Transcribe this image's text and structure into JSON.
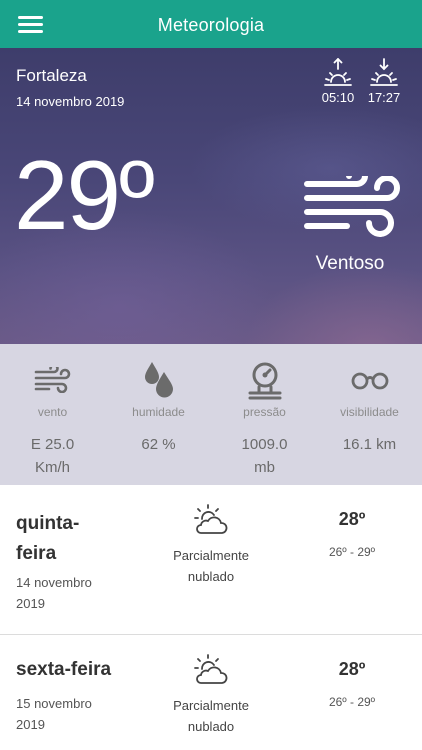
{
  "app": {
    "title": "Meteorologia",
    "accent_color": "#1aa38c",
    "menu_icon": "hamburger-menu-icon"
  },
  "current": {
    "city": "Fortaleza",
    "date": "14 novembro 2019",
    "sunrise": {
      "icon": "sunrise-icon",
      "time": "05:10"
    },
    "sunset": {
      "icon": "sunset-icon",
      "time": "17:27"
    },
    "temperature": "29º",
    "condition_icon": "wind-icon",
    "condition": "Ventoso"
  },
  "stats": [
    {
      "icon": "wind-icon",
      "label": "vento",
      "value_line1": "E 25.0",
      "value_line2": "Km/h"
    },
    {
      "icon": "humidity-drops-icon",
      "label": "humidade",
      "value_line1": "62 %",
      "value_line2": ""
    },
    {
      "icon": "pressure-gauge-icon",
      "label": "pressão",
      "value_line1": "1009.0",
      "value_line2": "mb"
    },
    {
      "icon": "visibility-glasses-icon",
      "label": "visibilidade",
      "value_line1": "16.1 km",
      "value_line2": ""
    }
  ],
  "forecast": [
    {
      "day_line1": "quinta-",
      "day_line2": "feira",
      "date_line1": "14 novembro",
      "date_line2": "2019",
      "icon": "partly-cloudy-icon",
      "condition_line1": "Parcialmente",
      "condition_line2": "nublado",
      "temp": "28º",
      "range": "26º - 29º"
    },
    {
      "day_line1": "sexta-feira",
      "day_line2": "",
      "date_line1": "15 novembro",
      "date_line2": "2019",
      "icon": "partly-cloudy-icon",
      "condition_line1": "Parcialmente",
      "condition_line2": "nublado",
      "temp": "28º",
      "range": "26º - 29º"
    }
  ]
}
